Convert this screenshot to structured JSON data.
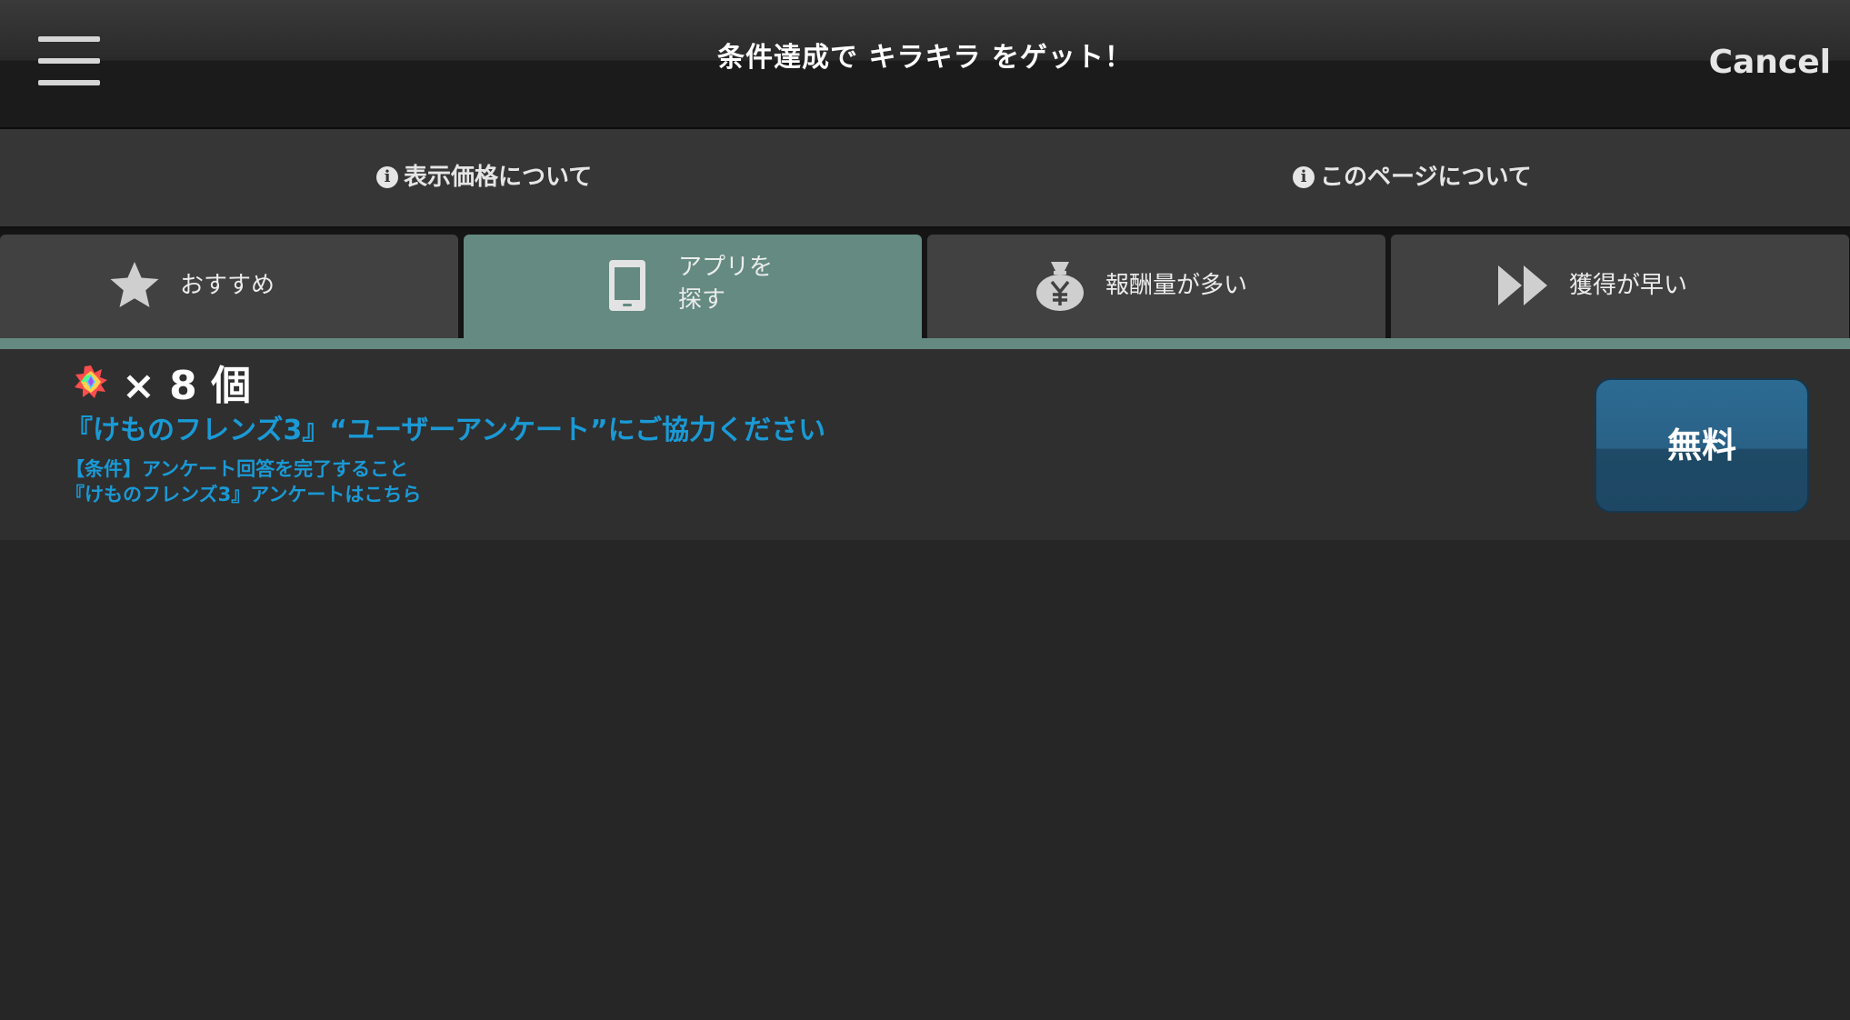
{
  "header": {
    "title": "条件達成で キラキラ をゲット！",
    "cancel_label": "Cancel",
    "menu_icon": "hamburger-menu-icon"
  },
  "info_bar": {
    "price_link": "表示価格について",
    "page_link": "このページについて",
    "icon": "info-circle-icon"
  },
  "tabs": [
    {
      "label": "おすすめ",
      "icon": "star-icon",
      "active": false
    },
    {
      "label_line1": "アプリを",
      "label_line2": "探す",
      "icon": "tablet-icon",
      "active": true
    },
    {
      "label": "報酬量が多い",
      "icon": "yen-bag-icon",
      "active": false
    },
    {
      "label": "獲得が早い",
      "icon": "fast-forward-icon",
      "active": false
    }
  ],
  "colors": {
    "accent": "#648a81",
    "link": "#1a9ad6",
    "button": "#2a6186"
  },
  "offers": [
    {
      "reward_icon": "rainbow-gem-icon",
      "reward_count": "× 8 個",
      "title": "『けものフレンズ3』“ユーザーアンケート”にご協力ください",
      "condition": "【条件】アンケート回答を完了すること",
      "link_text": "『けものフレンズ3』アンケートはこちら",
      "button_label": "無料"
    }
  ]
}
